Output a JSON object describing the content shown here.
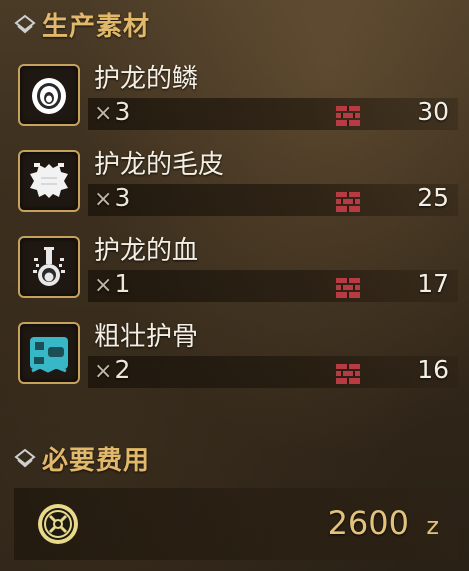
{
  "materials_header": {
    "title": "生产素材",
    "icon": "diamond-stack-icon"
  },
  "materials": [
    {
      "name": "护龙的鳞",
      "qty_prefix": "×",
      "qty": "3",
      "owned": "30",
      "icon": "scale-icon"
    },
    {
      "name": "护龙的毛皮",
      "qty_prefix": "×",
      "qty": "3",
      "owned": "25",
      "icon": "pelt-icon"
    },
    {
      "name": "护龙的血",
      "qty_prefix": "×",
      "qty": "1",
      "owned": "17",
      "icon": "blood-vial-icon"
    },
    {
      "name": "粗壮护骨",
      "qty_prefix": "×",
      "qty": "2",
      "owned": "16",
      "icon": "bone-icon"
    }
  ],
  "cost_header": {
    "title": "必要费用",
    "icon": "diamond-stack-icon"
  },
  "cost": {
    "value": "2600",
    "unit": "z",
    "icon": "zenny-coin-icon"
  },
  "colors": {
    "accent_gold": "#e2b86a",
    "item_box_red": "#b83a42",
    "blood_icon_white": "#e8e8e8",
    "bone_icon_teal": "#38b7c7"
  }
}
